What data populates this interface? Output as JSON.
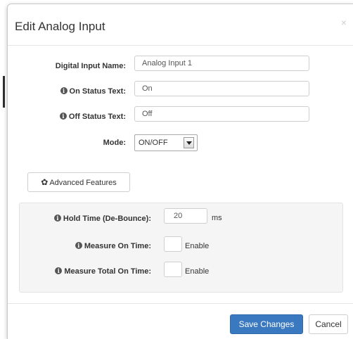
{
  "modal": {
    "title": "Edit Analog Input",
    "close_glyph": "×"
  },
  "form": {
    "name": {
      "label": "Digital Input Name:",
      "value": "Analog Input 1"
    },
    "on_status": {
      "label": "On Status Text:",
      "value": "On"
    },
    "off_status": {
      "label": "Off Status Text:",
      "value": "Off"
    },
    "mode": {
      "label": "Mode:",
      "value": "ON/OFF"
    }
  },
  "advanced": {
    "button_label": "Advanced Features",
    "hold_time": {
      "label": "Hold Time (De-Bounce):",
      "value": "20",
      "unit": "ms"
    },
    "measure_on_time": {
      "label": "Measure On Time:",
      "option": "Enable",
      "checked": false
    },
    "measure_total_on_time": {
      "label": "Measure Total On Time:",
      "option": "Enable",
      "checked": false
    }
  },
  "footer": {
    "save_label": "Save Changes",
    "cancel_label": "Cancel"
  },
  "colors": {
    "primary": "#3a79c0",
    "panel_bg": "#f5f5f5"
  }
}
